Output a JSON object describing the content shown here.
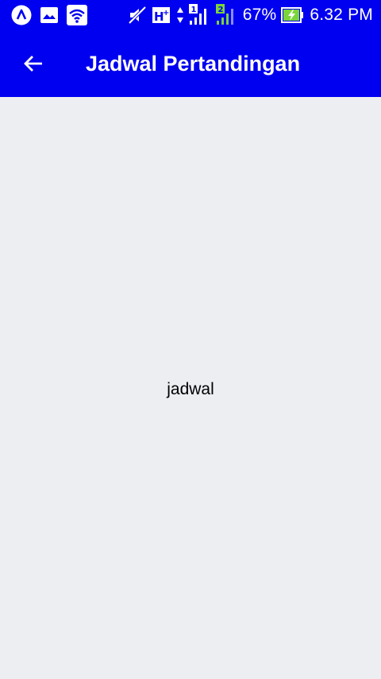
{
  "status_bar": {
    "icons": [
      "notification-a-icon",
      "image-icon",
      "wifi-icon",
      "mute-icon",
      "h-plus-icon",
      "data-arrows-icon",
      "signal-sim1-icon",
      "signal-sim2-icon",
      "battery-charging-icon"
    ],
    "sim1_label": "1",
    "sim2_label": "2",
    "network_type": "H+",
    "battery_percent": "67%",
    "time": "6.32 PM"
  },
  "app_bar": {
    "title": "Jadwal Pertandingan",
    "back_icon": "arrow-back-icon"
  },
  "main": {
    "text": "jadwal"
  },
  "colors": {
    "primary": "#0000f0",
    "background": "#eceef2",
    "signal_green": "#7bd43b"
  }
}
